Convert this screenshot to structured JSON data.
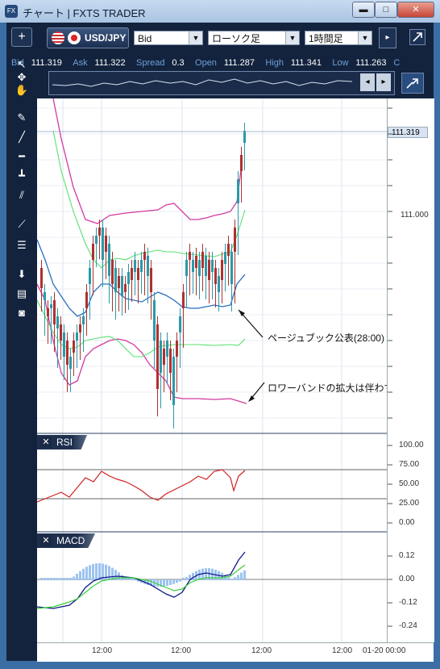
{
  "window": {
    "title": "チャート | FXTS TRADER",
    "app_icon": "FX",
    "buttons": [
      "▬",
      "□",
      "✕"
    ]
  },
  "toolbar": {
    "add_label": "+",
    "symbol": "USD/JPY",
    "price_type": "Bid",
    "chart_type": "ローソク足",
    "timeframe": "1時間足",
    "expand_icon": "expand-icon"
  },
  "quote": {
    "bid_label": "Bid",
    "bid": "111.319",
    "ask_label": "Ask",
    "ask": "111.322",
    "spread_label": "Spread",
    "spread": "0.3",
    "open_label": "Open",
    "open": "111.287",
    "high_label": "High",
    "high": "111.341",
    "low_label": "Low",
    "low": "111.263",
    "extra_label": "C"
  },
  "price_axis": {
    "current_price": "111.319",
    "label_111": "111.000"
  },
  "annotations": {
    "page_book": "ページュブック公表(28:00)",
    "lower_band": "ロワーバンドの拡大は伴わず"
  },
  "rsi": {
    "title": "RSI",
    "ticks": [
      "100.00",
      "75.00",
      "50.00",
      "25.00",
      "0.00"
    ]
  },
  "macd": {
    "title": "MACD",
    "ticks": [
      "0.12",
      "0.00",
      "-0.12",
      "-0.24"
    ]
  },
  "time_axis": {
    "ticks": [
      "12:00",
      "12:00",
      "12:00",
      "12:00",
      "01-20 00:00"
    ]
  },
  "colors": {
    "bull": "#2a9aa8",
    "bear": "#b03030",
    "bb_outer": "#d23aa0",
    "bb_inner": "#58e070",
    "mid": "#2a6ec0",
    "rsi": "#d02020",
    "macd": "#101a8c",
    "signal": "#38d038"
  }
}
